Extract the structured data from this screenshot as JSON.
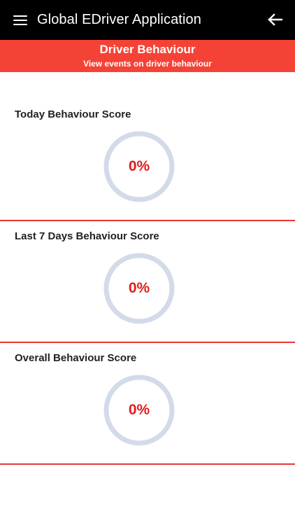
{
  "app_bar": {
    "title": "Global EDriver Application",
    "menu_icon": "hamburger-menu-icon",
    "back_icon": "arrow-left-icon",
    "background": "#000000"
  },
  "banner": {
    "title": "Driver Behaviour",
    "subtitle": "View events on driver behaviour",
    "background": "#f44336"
  },
  "scores": [
    {
      "title": "Today Behaviour Score",
      "value": "0%",
      "progress": 0
    },
    {
      "title": "Last 7 Days Behaviour Score",
      "value": "0%",
      "progress": 0
    },
    {
      "title": "Overall Behaviour Score",
      "value": "0%",
      "progress": 0
    }
  ],
  "colors": {
    "accent_red": "#e31b1b",
    "divider_red": "#e53935",
    "gauge_track": "#d3dbe9"
  }
}
